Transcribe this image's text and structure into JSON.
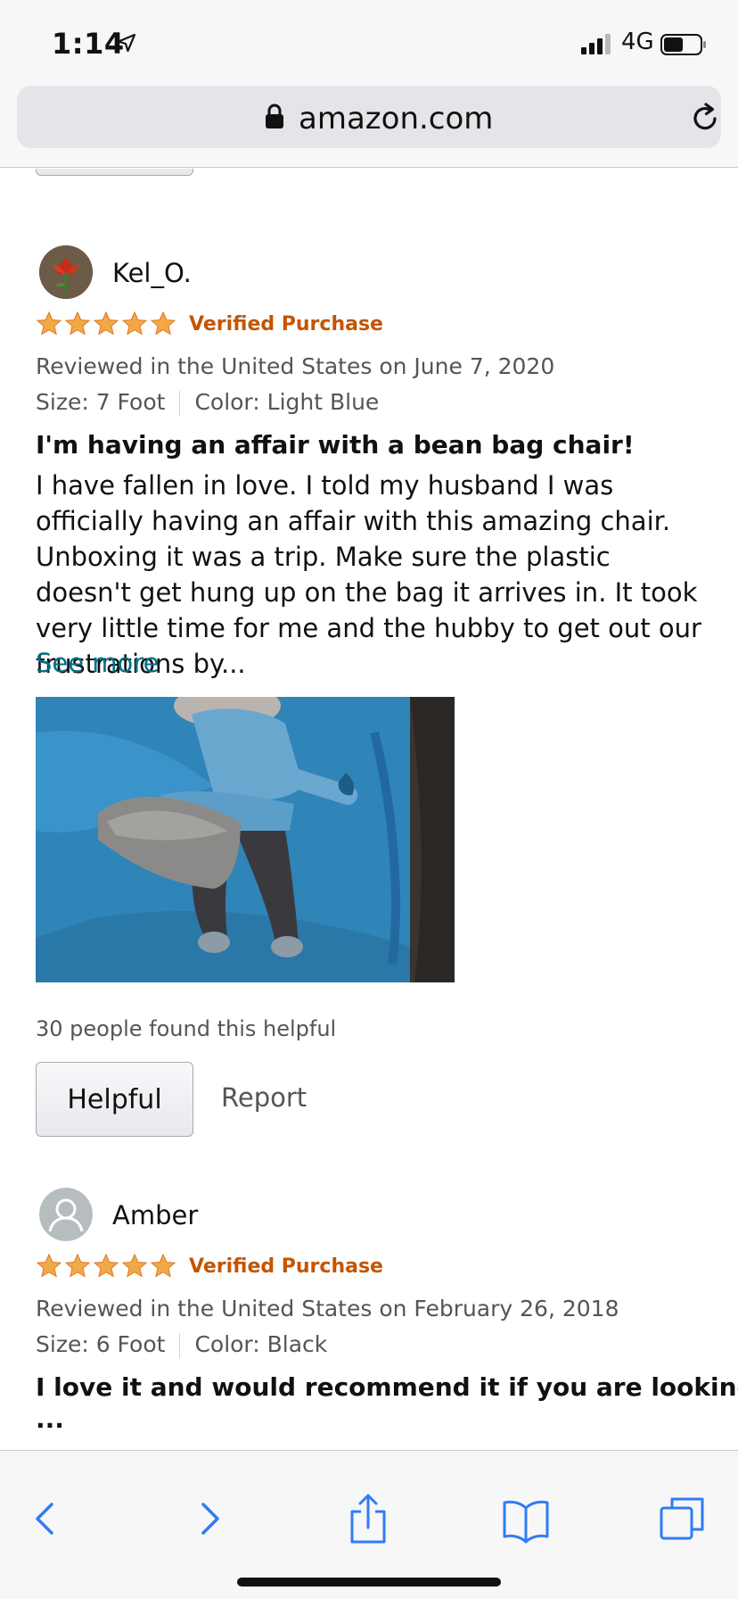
{
  "status_bar": {
    "time": "1:14",
    "network": "4G",
    "location_icon": "location-arrow-icon",
    "signal_icon": "signal-bars-icon",
    "battery_icon": "battery-icon"
  },
  "browser": {
    "url": "amazon.com",
    "lock_icon": "lock-icon",
    "reload_icon": "reload-icon"
  },
  "reviews": [
    {
      "reviewer": "Kel_O.",
      "avatar_icon": "flower-avatar",
      "rating": 5,
      "rating_max": 5,
      "verified": "Verified Purchase",
      "reviewed_line": "Reviewed in the United States on June 7, 2020",
      "size": "Size: 7 Foot",
      "color": "Color: Light Blue",
      "title": "I'm having an affair with a bean bag chair!",
      "body": "I have fallen in love. I told my husband I was officially having an affair with this amazing chair. Unboxing it was a trip. Make sure the plastic doesn't get hung up on the bag it arrives in. It took very little time for me and the hubby to get out our frustrations by...",
      "see_more": "See more",
      "helpful_count": "30 people found this helpful",
      "helpful_button": "Helpful",
      "report": "Report"
    },
    {
      "reviewer": "Amber",
      "avatar_icon": "default-user-avatar",
      "rating": 5,
      "rating_max": 5,
      "verified": "Verified Purchase",
      "reviewed_line": "Reviewed in the United States on February 26, 2018",
      "size": "Size: 6 Foot",
      "color": "Color: Black",
      "title": "I love it and would recommend it if you are looking",
      "title_ellipsis": "..."
    }
  ],
  "toolbar": {
    "back_icon": "back-chevron-icon",
    "forward_icon": "forward-chevron-icon",
    "share_icon": "share-icon",
    "bookmarks_icon": "book-icon",
    "tabs_icon": "tabs-icon"
  },
  "colors": {
    "star": "#f3a847",
    "verified": "#c45500",
    "link": "#007185",
    "ios_blue": "#2f7cf6"
  }
}
